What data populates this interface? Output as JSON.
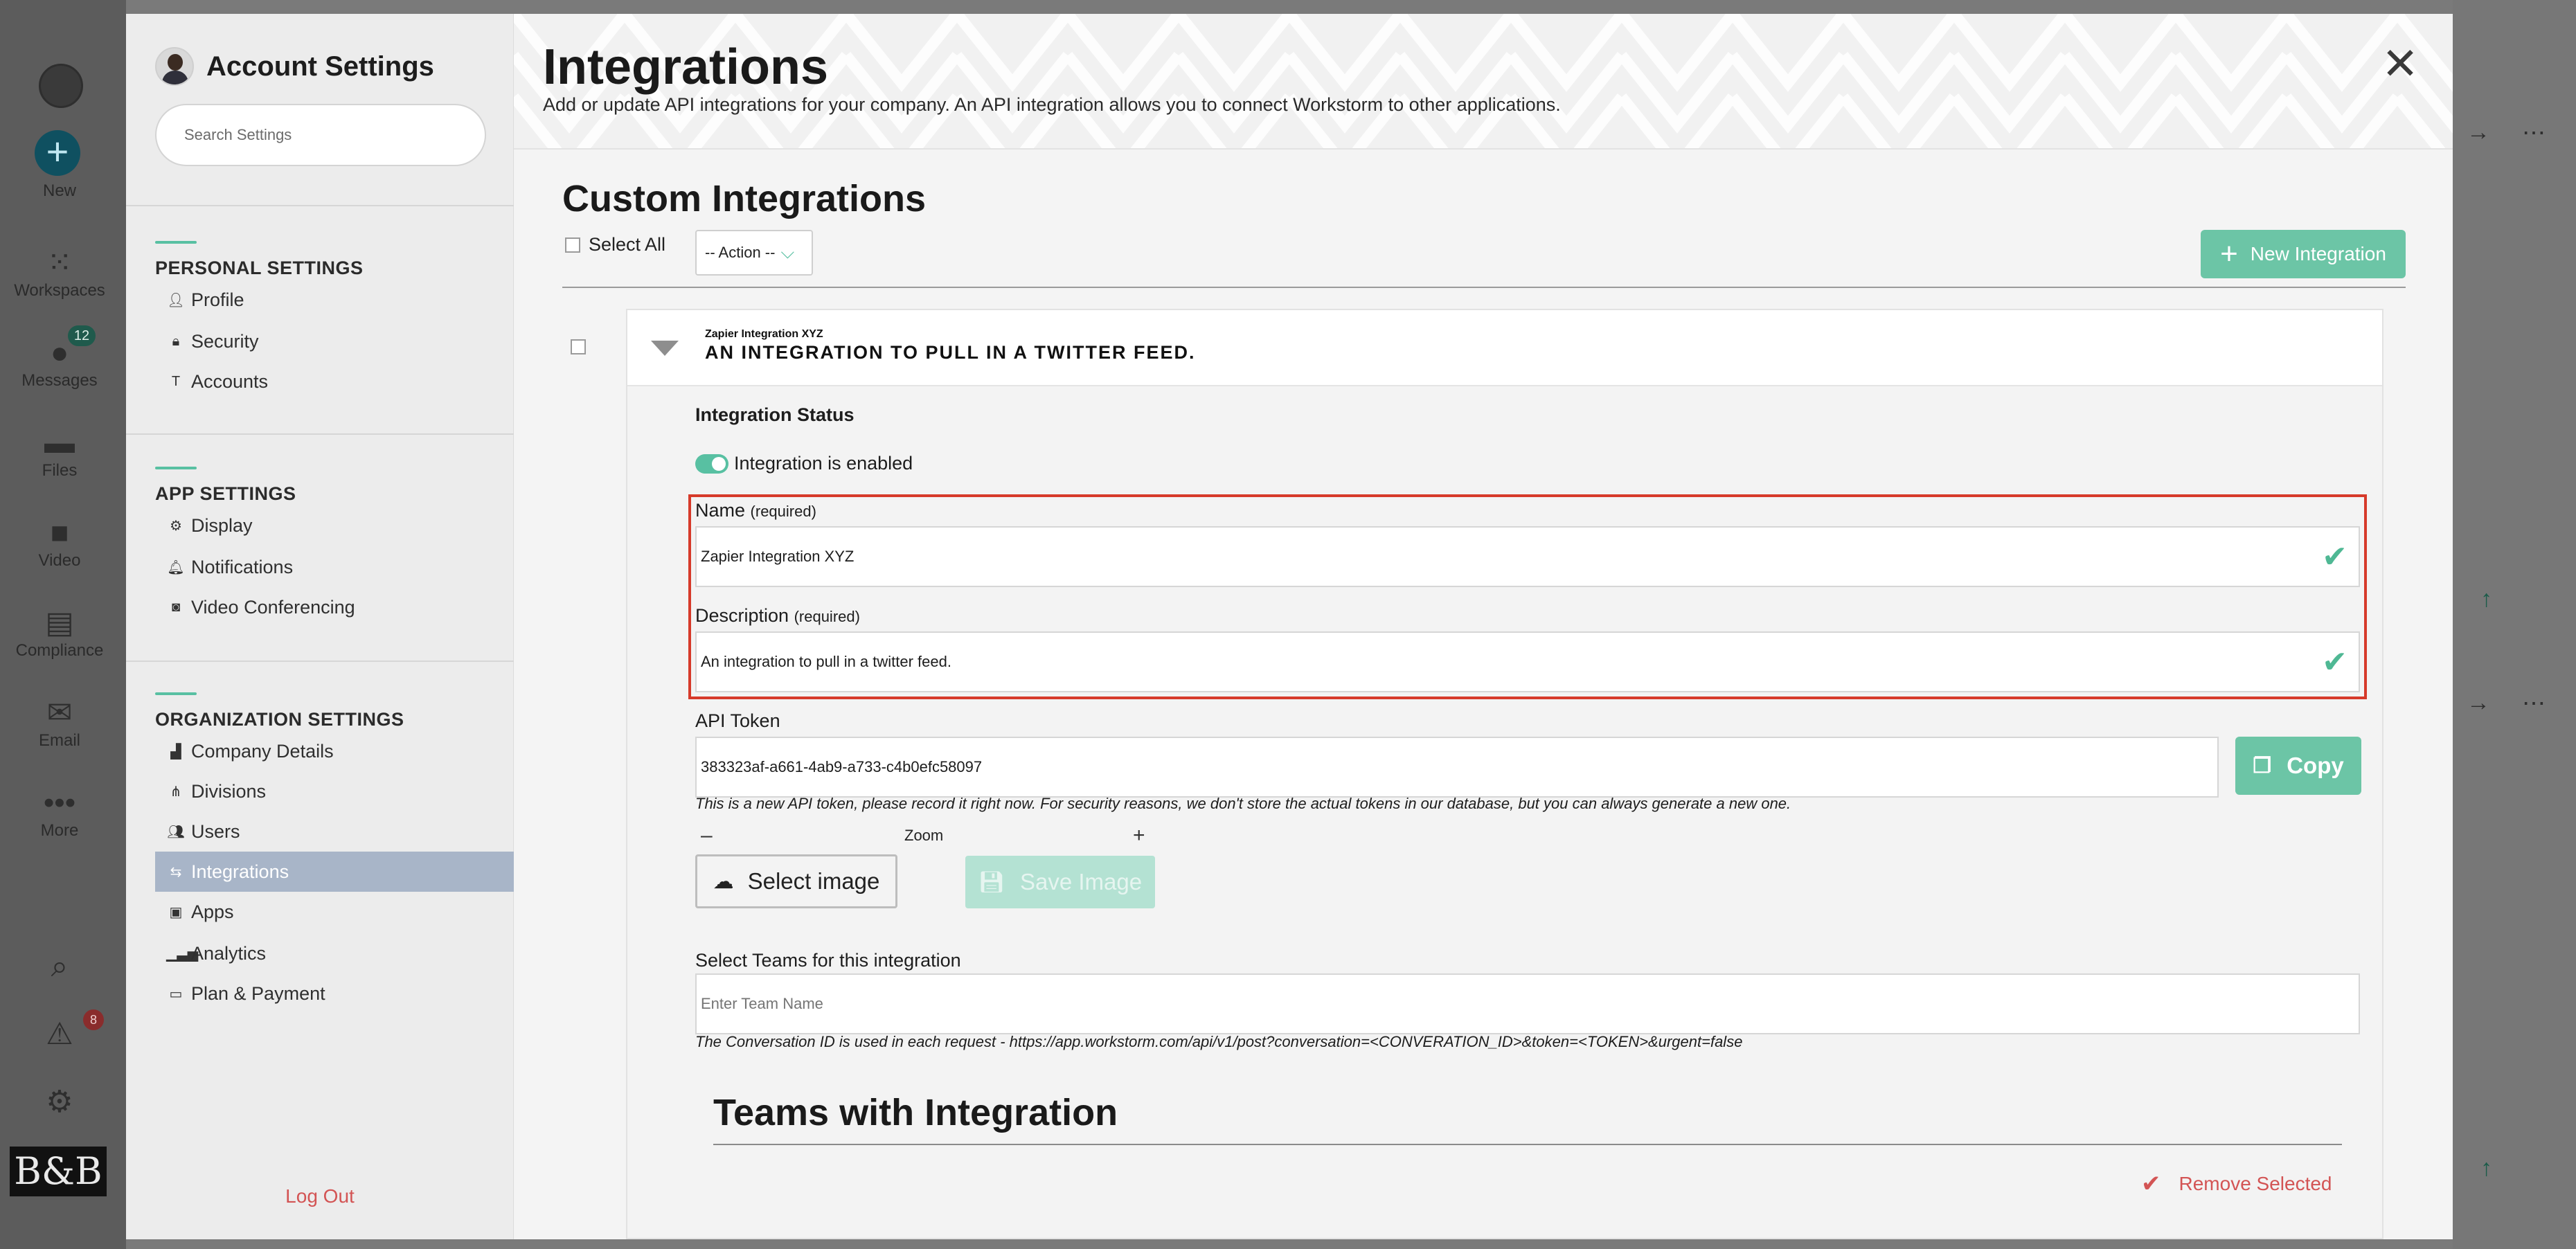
{
  "rail": {
    "new_label": "New",
    "workspaces_label": "Workspaces",
    "messages_label": "Messages",
    "messages_badge": "12",
    "files_label": "Files",
    "video_label": "Video",
    "compliance_label": "Compliance",
    "email_label": "Email",
    "more_label": "More",
    "logo_text": "B&B",
    "alert_badge": "8"
  },
  "sidebar": {
    "title": "Account Settings",
    "search_placeholder": "Search Settings",
    "personal_title": "PERSONAL SETTINGS",
    "personal_items": [
      {
        "label": "Profile",
        "icon": "person-icon"
      },
      {
        "label": "Security",
        "icon": "lock-icon"
      },
      {
        "label": "Accounts",
        "icon": "text-icon"
      }
    ],
    "app_title": "APP SETTINGS",
    "app_items": [
      {
        "label": "Display",
        "icon": "gear-icon"
      },
      {
        "label": "Notifications",
        "icon": "bell-icon"
      },
      {
        "label": "Video Conferencing",
        "icon": "camera-icon"
      }
    ],
    "org_title": "ORGANIZATION SETTINGS",
    "org_items": [
      {
        "label": "Company Details",
        "icon": "building-icon"
      },
      {
        "label": "Divisions",
        "icon": "hierarchy-icon"
      },
      {
        "label": "Users",
        "icon": "users-icon"
      },
      {
        "label": "Integrations",
        "icon": "swap-icon",
        "active": true
      },
      {
        "label": "Apps",
        "icon": "app-icon"
      },
      {
        "label": "Analytics",
        "icon": "bar-chart-icon"
      },
      {
        "label": "Plan & Payment",
        "icon": "card-icon"
      }
    ],
    "logout_label": "Log Out"
  },
  "header": {
    "title": "Integrations",
    "subtitle": "Add or update API integrations for your company. An API integration allows you to connect Workstorm to other applications."
  },
  "custom": {
    "title": "Custom Integrations",
    "select_all_label": "Select All",
    "action_label": "-- Action --",
    "new_button_label": "New Integration"
  },
  "integration": {
    "small_name": "Zapier Integration XYZ",
    "heading": "AN INTEGRATION TO PULL IN A TWITTER FEED.",
    "status_label": "Integration Status",
    "status_text": "Integration is enabled",
    "name_label": "Name",
    "name_required": "(required)",
    "name_value": "Zapier Integration XYZ",
    "desc_label": "Description",
    "desc_required": "(required)",
    "desc_value": "An integration to pull in a twitter feed.",
    "token_label": "API Token",
    "token_value": "383323af-a661-4ab9-a733-c4b0efc58097",
    "copy_label": "Copy",
    "token_note": "This is a new API token, please record it right now. For security reasons, we don't store the actual tokens in our database, but you can always generate a new one.",
    "zoom_minus": "–",
    "zoom_label": "Zoom",
    "zoom_plus": "+",
    "select_image_label": "Select image",
    "save_image_label": "Save Image",
    "teams_label": "Select Teams for this integration",
    "teams_placeholder": "Enter Team Name",
    "conversation_note": "The Conversation ID is used in each request - https://app.workstorm.com/api/v1/post?conversation=<CONVERATION_ID>&token=<TOKEN>&urgent=false",
    "teams_title": "Teams with Integration",
    "remove_selected_label": "Remove Selected"
  },
  "colors": {
    "accent": "#6cc5a6",
    "danger": "#d35454",
    "highlight_border": "#d63a2a",
    "active_nav": "#a8b5c8"
  }
}
